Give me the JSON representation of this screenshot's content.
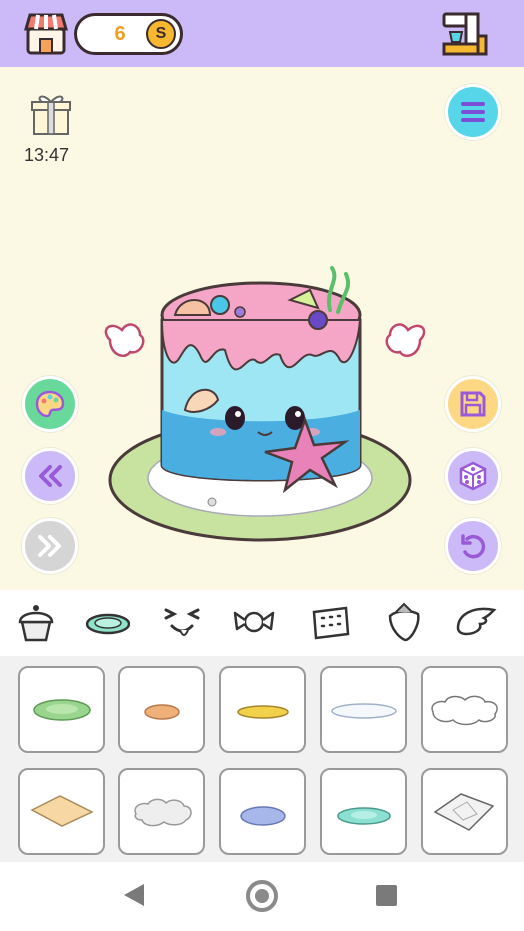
{
  "header": {
    "coins": "6",
    "coin_symbol": "S",
    "shop_icon": "shop-icon",
    "machine_icon": "baking-machine-icon"
  },
  "gift": {
    "icon": "gift-icon",
    "timer": "13:47"
  },
  "side_buttons": {
    "left": [
      "palette-icon",
      "rewind-icon",
      "fast-forward-icon"
    ],
    "right": [
      "menu-icon",
      "save-icon",
      "dice-icon",
      "undo-icon"
    ]
  },
  "cake": {
    "decorations": [
      "starfish",
      "seashell",
      "pearls",
      "seaweed",
      "wings"
    ]
  },
  "categories": [
    "cupcake-icon",
    "plate-icon",
    "face-icon",
    "candy-icon",
    "cracker-icon",
    "strawberry-icon",
    "wing-icon"
  ],
  "selected_category": "plate-icon",
  "items": [
    {
      "name": "plate-green",
      "color": "#9ad58f"
    },
    {
      "name": "plate-orange",
      "color": "#f0b07a"
    },
    {
      "name": "plate-gold",
      "color": "#f2d14a"
    },
    {
      "name": "plate-white",
      "color": "#f4f7fb"
    },
    {
      "name": "plate-cloud",
      "color": "#ffffff"
    },
    {
      "name": "plate-napkin",
      "color": "#f7d8a4"
    },
    {
      "name": "plate-cloud-grey",
      "color": "#eeeeee"
    },
    {
      "name": "plate-blue",
      "color": "#a8b7ea"
    },
    {
      "name": "plate-teal",
      "color": "#8be0d2"
    },
    {
      "name": "plate-lace",
      "color": "#f2f2f2"
    }
  ],
  "colors": {
    "topbar": "#cbbaf7",
    "background": "#fbf8e4",
    "accent_cyan": "#56d6e8",
    "accent_green": "#68d99b",
    "accent_yellow": "#fcd885"
  }
}
